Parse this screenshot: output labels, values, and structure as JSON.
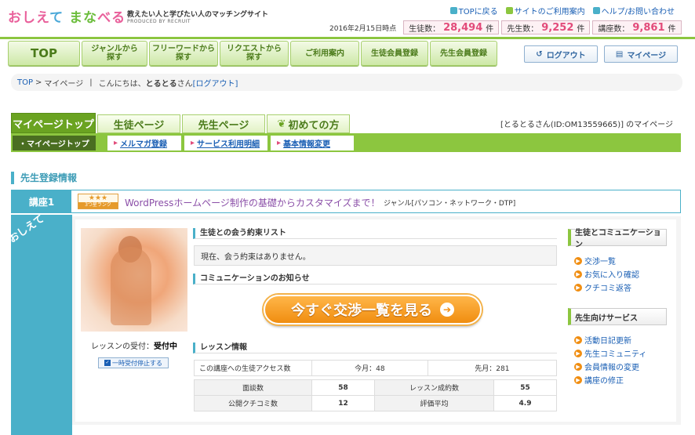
{
  "site": {
    "logo_text": "おしえて まなべる",
    "tagline": "教えたい人と学びたい人のマッチングサイト",
    "produced_by": "PRODUCED BY RECRUIT"
  },
  "top_links": [
    {
      "label": "TOPに戻る",
      "icon": "home-icon"
    },
    {
      "label": "サイトのご利用案内",
      "icon": "guide-icon"
    },
    {
      "label": "ヘルプ/お問い合わせ",
      "icon": "help-icon"
    }
  ],
  "stats": {
    "as_of": "2016年2月15日時点",
    "students_label": "生徒数：",
    "students_value": "28,494",
    "students_unit": "件",
    "teachers_label": "先生数：",
    "teachers_value": "9,252",
    "teachers_unit": "件",
    "courses_label": "講座数：",
    "courses_value": "9,861",
    "courses_unit": "件"
  },
  "nav": {
    "top": "TOP",
    "genre": [
      "ジャンルから",
      "探す"
    ],
    "freeword": [
      "フリーワードから",
      "探す"
    ],
    "request": [
      "リクエストから",
      "探す"
    ],
    "guide": "ご利用案内",
    "student_reg": "生徒会員登録",
    "teacher_reg": "先生会員登録",
    "logout": "ログアウト",
    "mypage": "マイページ"
  },
  "breadcrumb": {
    "top": "TOP",
    "sep": ">",
    "mypage": "マイページ",
    "bar": "|",
    "greeting_pre": "こんにちは、",
    "user": "とるとる",
    "greeting_post": "さん",
    "logout": "[ログアウト]"
  },
  "tabs": [
    "マイページトップ",
    "生徒ページ",
    "先生ページ",
    "初めての方"
  ],
  "mypage_owner": "[とるとるさん(ID:OM13559665)] のマイページ",
  "subtabs": {
    "active": "・マイページトップ",
    "mark": "▸",
    "links": [
      "メルマガ登録",
      "サービス利用明細",
      "基本情報変更"
    ]
  },
  "section_title": "先生登録情報",
  "course": {
    "number": "講座1",
    "rank_stars": "★★★",
    "rank_label": "3つ星ランク",
    "title": "WordPressホームページ制作の基礎からカスタマイズまで！",
    "genre": "ジャンル[パソコン・ネットワーク・DTP]"
  },
  "badge": "おしえて",
  "lesson_accept_label": "レッスンの受付：",
  "lesson_accept_value": "受付中",
  "stop_button": "一時受付停止する",
  "promise_heading": "生徒との会う約束リスト",
  "promise_text": "現在、会う約束はありません。",
  "comm_heading": "コミュニケーションのお知らせ",
  "big_button": "今すぐ交渉一覧を見る",
  "lesson_heading": "レッスン情報",
  "access": {
    "label": "この講座への生徒アクセス数",
    "this_month": "今月：48",
    "last_month": "先月：281"
  },
  "lesson_table": [
    [
      "面談数",
      "58",
      "レッスン成約数",
      "55"
    ],
    [
      "公開クチコミ数",
      "12",
      "評価平均",
      "4.9"
    ]
  ],
  "side_student": {
    "title": "生徒とコミュニケーション",
    "items": [
      "交渉一覧",
      "お気に入り確認",
      "クチコミ返答"
    ]
  },
  "side_teacher": {
    "title": "先生向けサービス",
    "items": [
      "活動日記更新",
      "先生コミュニティ",
      "会員情報の変更",
      "講座の修正"
    ]
  },
  "colors": {
    "accent_green": "#8cc63f",
    "accent_blue": "#4ab0c9",
    "pink": "#e24b7a",
    "orange": "#f08d10"
  }
}
